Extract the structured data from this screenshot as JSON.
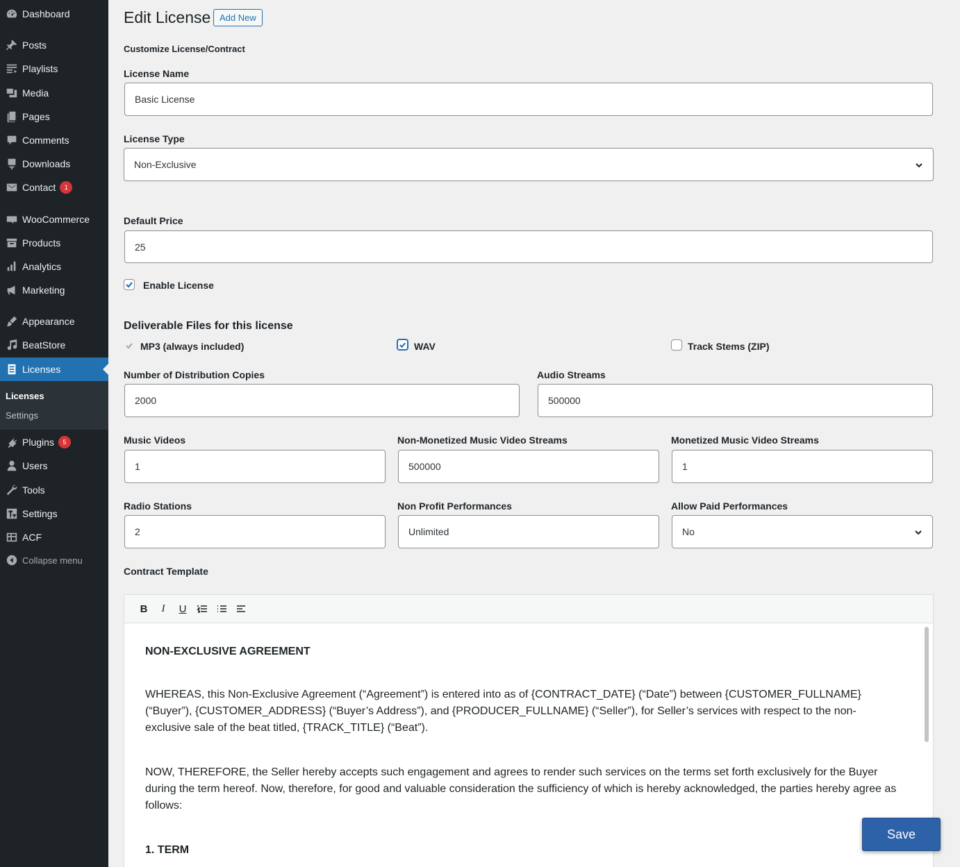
{
  "sidebar": {
    "items": [
      {
        "label": "Dashboard",
        "icon": "dashboard-icon"
      },
      {
        "label": "Posts",
        "icon": "pin-icon"
      },
      {
        "label": "Playlists",
        "icon": "playlist-icon"
      },
      {
        "label": "Media",
        "icon": "media-icon"
      },
      {
        "label": "Pages",
        "icon": "pages-icon"
      },
      {
        "label": "Comments",
        "icon": "comment-icon"
      },
      {
        "label": "Downloads",
        "icon": "download-icon"
      },
      {
        "label": "Contact",
        "icon": "mail-icon",
        "badge": "1"
      },
      {
        "label": "WooCommerce",
        "icon": "woocommerce-icon"
      },
      {
        "label": "Products",
        "icon": "archive-icon"
      },
      {
        "label": "Analytics",
        "icon": "bar-chart-icon"
      },
      {
        "label": "Marketing",
        "icon": "megaphone-icon"
      },
      {
        "label": "Appearance",
        "icon": "brush-icon"
      },
      {
        "label": "BeatStore",
        "icon": "music-note-icon"
      },
      {
        "label": "Licenses",
        "icon": "document-icon"
      },
      {
        "label": "Plugins",
        "icon": "plugin-icon",
        "badge": "5"
      },
      {
        "label": "Users",
        "icon": "user-icon"
      },
      {
        "label": "Tools",
        "icon": "wrench-icon"
      },
      {
        "label": "Settings",
        "icon": "settings-icon"
      },
      {
        "label": "ACF",
        "icon": "grid-icon"
      }
    ],
    "submenu": [
      "Licenses",
      "Settings"
    ],
    "collapse": "Collapse menu"
  },
  "header": {
    "title": "Edit License",
    "add_new": "Add New"
  },
  "subtitle": "Customize License/Contract",
  "form": {
    "license_name": {
      "label": "License Name",
      "value": "Basic License"
    },
    "license_type": {
      "label": "License Type",
      "value": "Non-Exclusive"
    },
    "default_price": {
      "label": "Default Price",
      "value": "25"
    },
    "enable_license": {
      "label": "Enable License",
      "checked": true
    },
    "deliverables": {
      "heading": "Deliverable Files for this license",
      "mp3": {
        "label": "MP3 (always included)",
        "checked": true,
        "disabled": true
      },
      "wav": {
        "label": "WAV",
        "checked": true
      },
      "stems": {
        "label": "Track Stems (ZIP)",
        "checked": false
      }
    },
    "distribution_copies": {
      "label": "Number of Distribution Copies",
      "value": "2000"
    },
    "audio_streams": {
      "label": "Audio Streams",
      "value": "500000"
    },
    "music_videos": {
      "label": "Music Videos",
      "value": "1"
    },
    "non_monetized_streams": {
      "label": "Non-Monetized Music Video Streams",
      "value": "500000"
    },
    "monetized_streams": {
      "label": "Monetized Music Video Streams",
      "value": "1"
    },
    "radio_stations": {
      "label": "Radio Stations",
      "value": "2"
    },
    "non_profit_performances": {
      "label": "Non Profit Performances",
      "value": "Unlimited"
    },
    "paid_performances": {
      "label": "Allow Paid Performances",
      "value": "No"
    },
    "contract_template": {
      "label": "Contract Template",
      "toolbar": [
        "B",
        "I",
        "U"
      ],
      "heading": "NON-EXCLUSIVE AGREEMENT",
      "para1": "WHEREAS, this Non-Exclusive Agreement (“Agreement”) is entered into as of {CONTRACT_DATE} (“Date”) between {CUSTOMER_FULLNAME} (“Buyer”), {CUSTOMER_ADDRESS} (“Buyer’s Address”), and {PRODUCER_FULLNAME} (“Seller”), for Seller’s services with respect to the non-exclusive sale of the beat titled, {TRACK_TITLE} (“Beat”).",
      "para2": "NOW, THEREFORE, the Seller hereby accepts such engagement and agrees to render such services on the terms set forth exclusively for the Buyer during the term hereof. Now, therefore, for good and valuable consideration the sufficiency of which is hereby acknowledged, the parties hereby agree as follows:",
      "section1": "1. TERM"
    }
  },
  "save_label": "Save",
  "colors": {
    "accent": "#2271b1",
    "sidebar_bg": "#1d2327",
    "badge": "#d63638"
  }
}
